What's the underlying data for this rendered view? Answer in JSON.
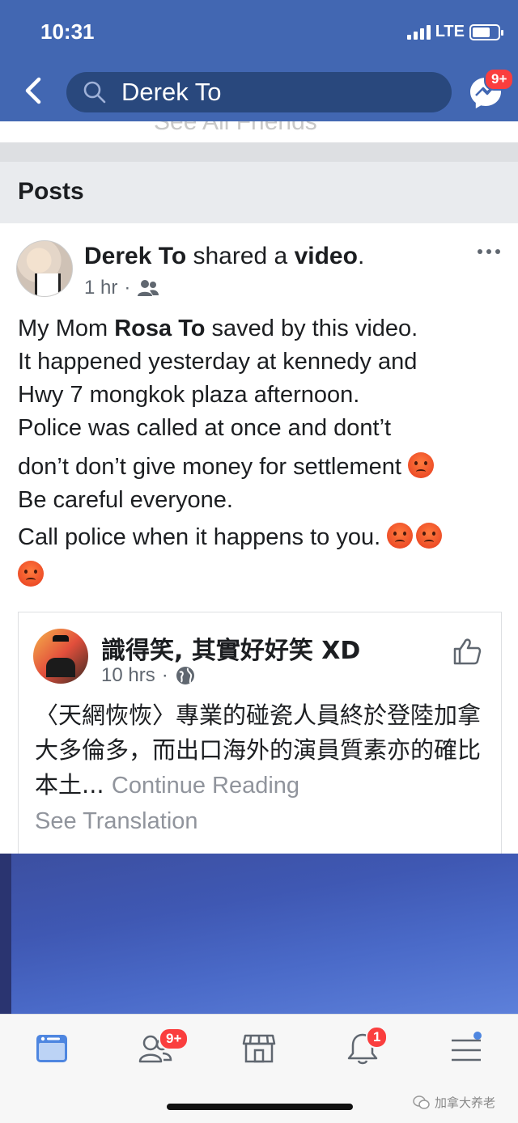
{
  "status": {
    "time": "10:31",
    "network": "LTE"
  },
  "search": {
    "query": "Derek To"
  },
  "messenger": {
    "badge": "9+"
  },
  "ghost_text": "See All Friends",
  "section": {
    "title": "Posts"
  },
  "post": {
    "author": "Derek To",
    "action_text": " shared a ",
    "object": "video",
    "period": ".",
    "time": "1 hr",
    "separator": "·",
    "body": {
      "l1_a": "My Mom ",
      "l1_b": "Rosa To",
      "l1_c": " saved by this video.",
      "l2": "It happened yesterday at kennedy and",
      "l3": "Hwy 7 mongkok plaza afternoon.",
      "l4": "Police was called at once and dont’t",
      "l5": "don’t don’t give money for settlement ",
      "l6": "Be careful everyone.",
      "l7": "Call police when it happens to you. "
    }
  },
  "shared": {
    "name": "識得笑, 其實好好笑 XD",
    "time": "10 hrs",
    "separator": "·",
    "text": "〈天網恢恢〉專業的碰瓷人員終於登陸加拿大多倫多，而出口海外的演員質素亦的確比本土... ",
    "continue": "Continue Reading",
    "translation": "See Translation"
  },
  "nav": {
    "friends_badge": "9+",
    "notifications_badge": "1"
  },
  "watermark": "加拿大养老",
  "colors": {
    "header": "#4267b2",
    "badge": "#fa3e3e",
    "accent": "#4267b2"
  }
}
